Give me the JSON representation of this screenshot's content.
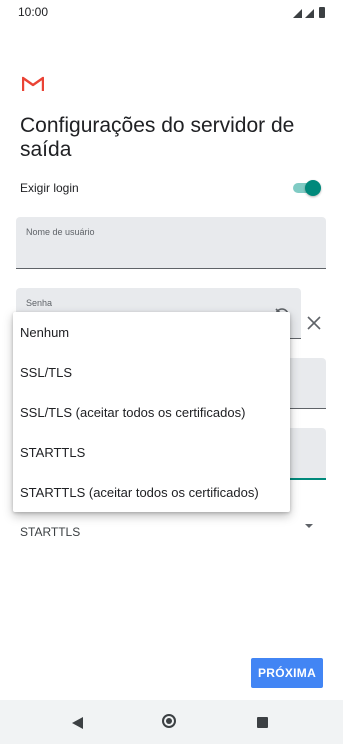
{
  "status_bar": {
    "time": "10:00"
  },
  "title": "Configurações do servidor de saída",
  "login": {
    "label": "Exigir login",
    "enabled": true
  },
  "username_field": {
    "label": "Nome de usuário",
    "value": ""
  },
  "password_field": {
    "label": "Senha",
    "value": ""
  },
  "security": {
    "selected": "STARTTLS"
  },
  "dropdown": {
    "options": [
      "Nenhum",
      "SSL/TLS",
      "SSL/TLS (aceitar todos os certificados)",
      "STARTTLS",
      "STARTTLS (aceitar todos os certificados)"
    ]
  },
  "next_button": {
    "label": "PRÓXIMA"
  },
  "colors": {
    "accent": "#00897b",
    "button": "#4285f4",
    "gmail_red": "#ea4335"
  },
  "icons": [
    "gmail-logo-icon",
    "visibility-icon",
    "close-icon",
    "back-icon",
    "home-icon",
    "recents-icon"
  ]
}
